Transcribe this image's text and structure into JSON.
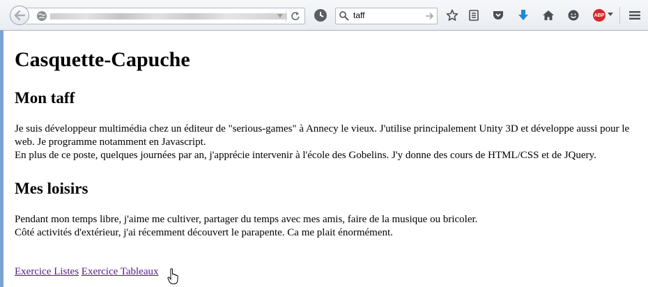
{
  "browser": {
    "search_query": "taff",
    "icons": [
      "back-arrow-icon",
      "globe-icon",
      "dropdown-arrow-icon",
      "reload-icon",
      "history-icon",
      "search-icon",
      "search-go-icon",
      "star-icon",
      "reading-list-icon",
      "pocket-icon",
      "download-icon",
      "home-icon",
      "hello-icon",
      "adblock-plus-icon",
      "menu-icon"
    ],
    "adblock_label": "ABP"
  },
  "page": {
    "title": "Casquette-Capuche",
    "section1": {
      "heading": "Mon taff",
      "line1": "Je suis développeur multimédia chez un éditeur de \"serious-games\" à Annecy le vieux. J'utilise principalement Unity 3D et développe aussi pour le web. Je programme notamment en Javascript.",
      "line2": "En plus de ce poste, quelques journées par an, j'apprécie intervenir à l'école des Gobelins. J'y donne des cours de HTML/CSS et de JQuery."
    },
    "section2": {
      "heading": "Mes loisirs",
      "line1": "Pendant mon temps libre, j'aime me cultiver, partager du temps avec mes amis, faire de la musique ou bricoler.",
      "line2": "Côté activités d'extérieur, j'ai récemment découvert le parapente. Ca me plait énormément."
    },
    "links": [
      "Exercice Listes",
      "Exercice Tableaux"
    ]
  },
  "colors": {
    "visited_link": "#551a8b",
    "abp_red": "#d9262c",
    "download_blue": "#1e8ad6"
  }
}
